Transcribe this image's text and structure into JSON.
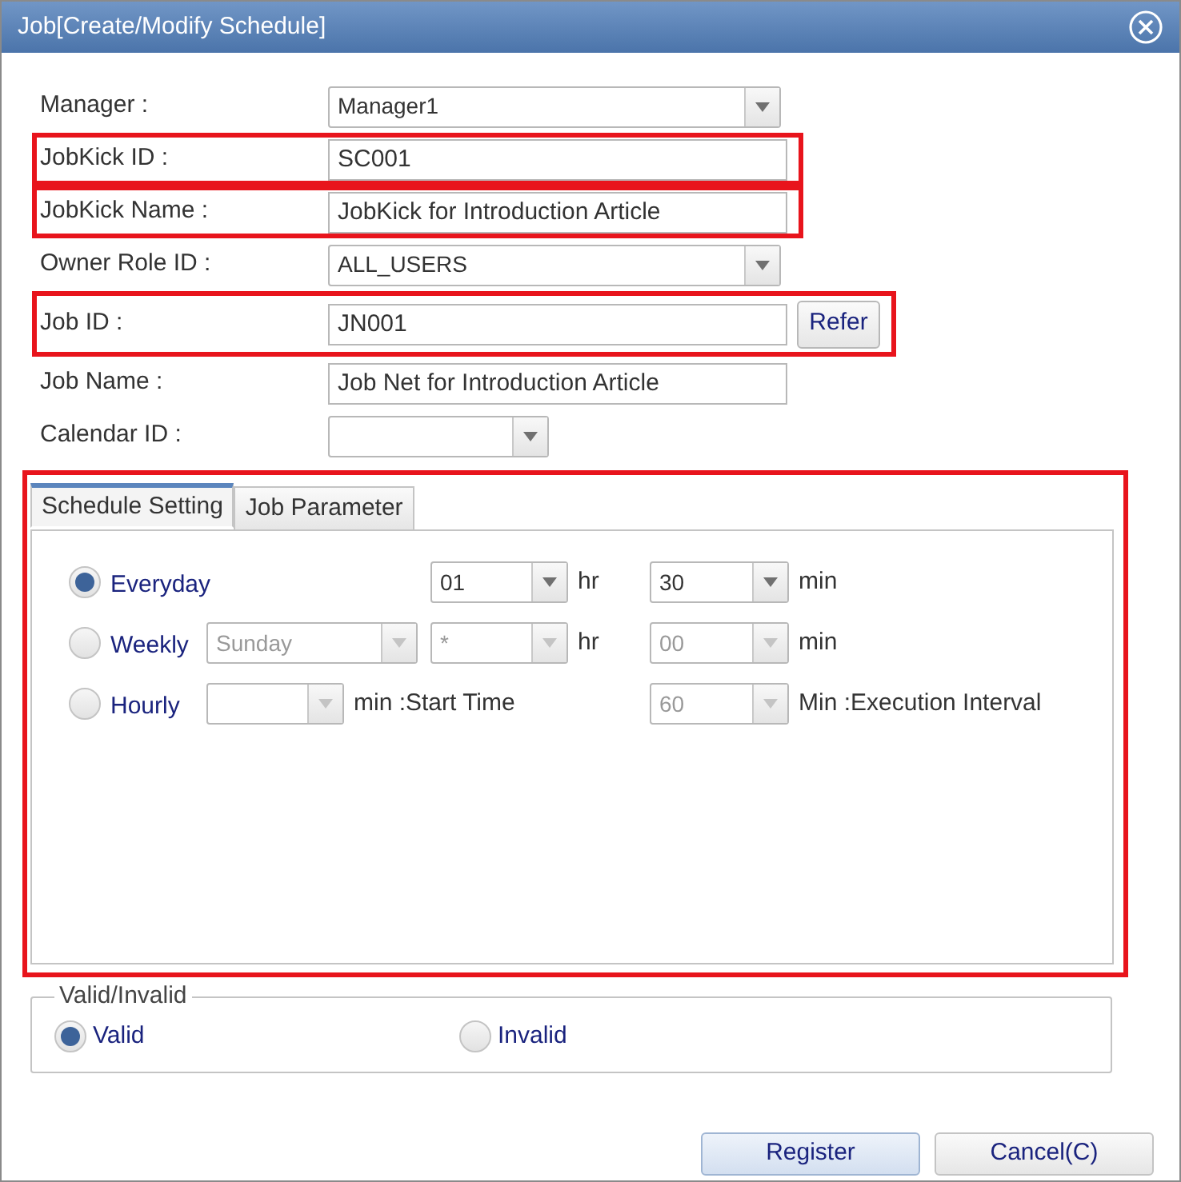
{
  "window": {
    "title": "Job[Create/Modify Schedule]"
  },
  "fields": [
    {
      "label": "Manager :",
      "kind": "select",
      "value": "Manager1",
      "highlighted": false
    },
    {
      "label": "JobKick ID :",
      "kind": "text",
      "value": "SC001",
      "highlighted": true
    },
    {
      "label": "JobKick Name :",
      "kind": "text",
      "value": "JobKick for Introduction Article",
      "highlighted": true
    },
    {
      "label": "Owner Role ID :",
      "kind": "select",
      "value": "ALL_USERS",
      "highlighted": false
    },
    {
      "label": "Job ID :",
      "kind": "text",
      "value": "JN001",
      "button": "Refer",
      "highlighted": true
    },
    {
      "label": "Job Name :",
      "kind": "text",
      "value": "Job Net for Introduction Article",
      "highlighted": false
    },
    {
      "label": "Calendar ID :",
      "kind": "short_select",
      "highlighted": false
    }
  ],
  "schedule": {
    "highlighted": true,
    "tabs": [
      {
        "label": "Schedule Setting",
        "selected": true
      },
      {
        "label": "Job Parameter",
        "selected": false
      }
    ],
    "rows": [
      {
        "label": "Everyday",
        "selected": true,
        "cells": [
          null,
          {
            "select": {
              "value": "01",
              "disabled": false
            },
            "unit": "hr"
          },
          {
            "select": {
              "value": "30",
              "disabled": false
            },
            "unit": "min"
          }
        ]
      },
      {
        "label": "Weekly",
        "selected": false,
        "cells": [
          {
            "select": {
              "value": "Sunday",
              "disabled": true
            }
          },
          {
            "select": {
              "value": "*",
              "disabled": true
            },
            "unit": "hr"
          },
          {
            "select": {
              "value": "00",
              "disabled": true
            },
            "unit": "min"
          }
        ]
      },
      {
        "label": "Hourly",
        "selected": false,
        "cells": [
          {
            "select": {
              "disabled": true
            },
            "unit": "min :Start Time"
          },
          null,
          {
            "select": {
              "value": "60",
              "disabled": true
            },
            "unit": "Min :Execution Interval"
          }
        ]
      }
    ]
  },
  "valid_group": {
    "legend": "Valid/Invalid",
    "options": [
      {
        "label": "Valid",
        "selected": true
      },
      {
        "label": "Invalid",
        "selected": false
      }
    ]
  },
  "buttons": [
    {
      "label": "Register",
      "kind": "primary"
    },
    {
      "label": "Cancel(C)",
      "kind": "secondary"
    }
  ]
}
